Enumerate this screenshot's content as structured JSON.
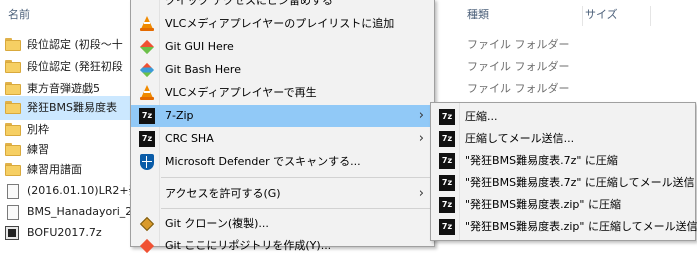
{
  "explorer": {
    "columns": {
      "name": "名前",
      "type": "種類",
      "size": "サイズ"
    },
    "files": [
      {
        "name": "段位認定 (初段～十",
        "icon": "folder-icon"
      },
      {
        "name": "段位認定 (発狂初段",
        "icon": "folder-icon"
      },
      {
        "name": "東方音弾遊戯5",
        "icon": "folder-icon"
      },
      {
        "name": "発狂BMS難易度表",
        "icon": "folder-icon"
      },
      {
        "name": "別枠",
        "icon": "folder-icon"
      },
      {
        "name": "練習",
        "icon": "folder-icon"
      },
      {
        "name": "練習用譜面",
        "icon": "folder-icon"
      },
      {
        "name": "(2016.01.10)LR2+発",
        "icon": "document-icon"
      },
      {
        "name": "BMS_Hanadayori_2",
        "icon": "document-icon"
      },
      {
        "name": "BOFU2017.7z",
        "icon": "archive-icon"
      }
    ],
    "types": [
      "ファイル フォルダー",
      "ファイル フォルダー",
      "ファイル フォルダー"
    ]
  },
  "context_menu": {
    "top_partial": "クイック アクセスにピン留めする",
    "items": [
      {
        "label": "VLCメディアプレイヤーのプレイリストに追加",
        "icon": "vlc-icon"
      },
      {
        "label": "Git GUI Here",
        "icon": "git-gui-icon"
      },
      {
        "label": "Git Bash Here",
        "icon": "git-bash-icon"
      },
      {
        "label": "VLCメディアプレイヤーで再生",
        "icon": "vlc-icon"
      },
      {
        "label": "7-Zip",
        "icon": "7zip-icon",
        "submenu": true
      },
      {
        "label": "CRC SHA",
        "icon": "7zip-icon",
        "submenu": true
      },
      {
        "label": "Microsoft Defender でスキャンする...",
        "icon": "defender-icon"
      },
      {
        "label": "アクセスを許可する(G)",
        "submenu": true
      },
      {
        "label": "Git クローン(複製)...",
        "icon": "git-clone-icon"
      },
      {
        "label": "Git ここにリポジトリを作成(Y)...",
        "icon": "git-repo-icon"
      }
    ]
  },
  "submenu_7zip": {
    "items": [
      {
        "label": "圧縮..."
      },
      {
        "label": "圧縮してメール送信..."
      },
      {
        "label": "\"発狂BMS難易度表.7z\" に圧縮"
      },
      {
        "label": "\"発狂BMS難易度表.7z\" に圧縮してメール送信"
      },
      {
        "label": "\"発狂BMS難易度表.zip\" に圧縮"
      },
      {
        "label": "\"発狂BMS難易度表.zip\" に圧縮してメール送信"
      }
    ]
  },
  "colors": {
    "selection": "#cce8ff",
    "menu_highlight": "#91c9f7",
    "menu_bg": "#f2f2f2"
  }
}
